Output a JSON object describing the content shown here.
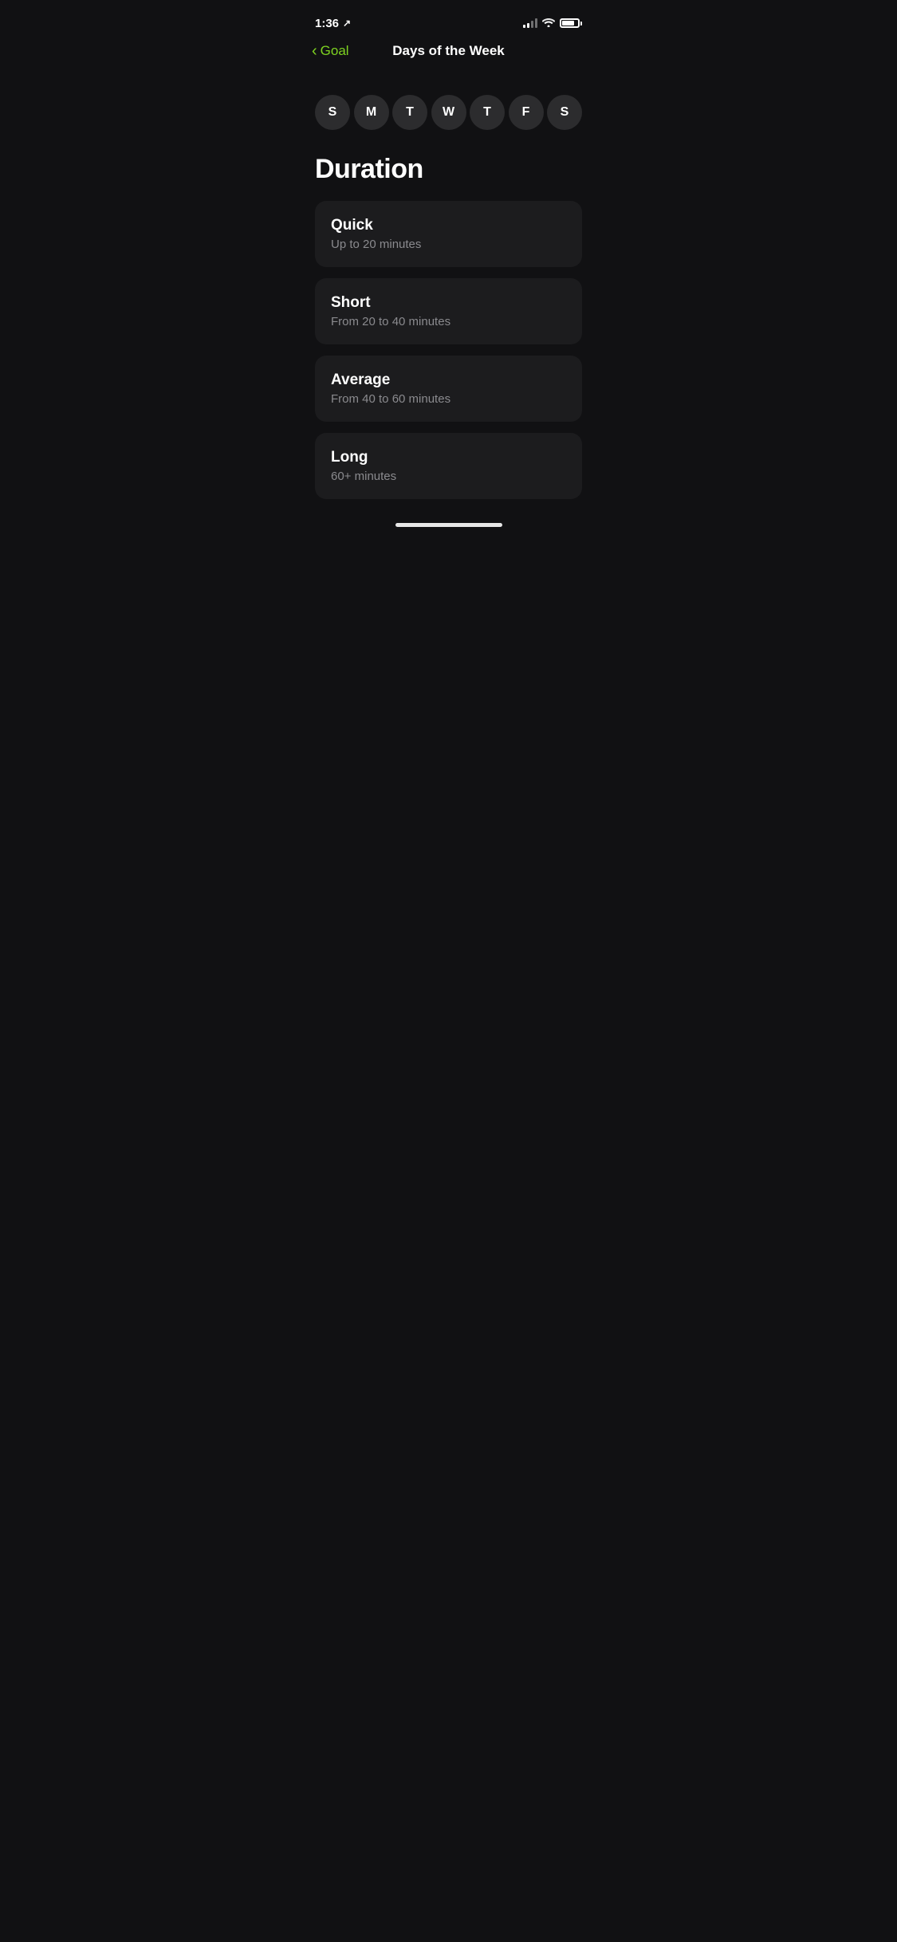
{
  "statusBar": {
    "time": "1:36",
    "hasLocation": true
  },
  "navigation": {
    "backLabel": "Goal",
    "title": "Days of the Week"
  },
  "days": [
    {
      "id": "sunday",
      "label": "S"
    },
    {
      "id": "monday",
      "label": "M"
    },
    {
      "id": "tuesday",
      "label": "T"
    },
    {
      "id": "wednesday",
      "label": "W"
    },
    {
      "id": "thursday",
      "label": "T"
    },
    {
      "id": "friday",
      "label": "F"
    },
    {
      "id": "saturday",
      "label": "S"
    }
  ],
  "durationSection": {
    "heading": "Duration",
    "cards": [
      {
        "id": "quick",
        "title": "Quick",
        "subtitle": "Up to 20 minutes"
      },
      {
        "id": "short",
        "title": "Short",
        "subtitle": "From 20 to 40 minutes"
      },
      {
        "id": "average",
        "title": "Average",
        "subtitle": "From 40 to 60 minutes"
      },
      {
        "id": "long",
        "title": "Long",
        "subtitle": "60+ minutes"
      }
    ]
  }
}
